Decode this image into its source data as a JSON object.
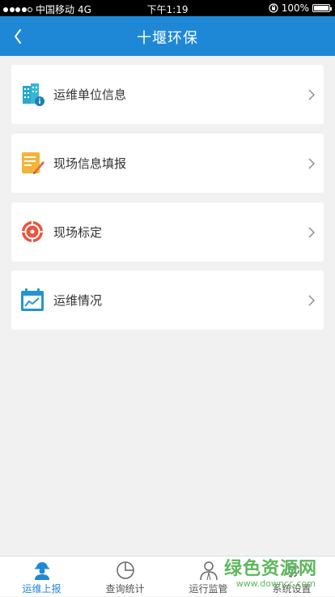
{
  "status_bar": {
    "carrier": "中国移动",
    "network": "4G",
    "time": "下午1:19",
    "battery": "100%"
  },
  "nav": {
    "title": "十堰环保"
  },
  "menu": [
    {
      "label": "运维单位信息",
      "icon": "building-info-icon"
    },
    {
      "label": "现场信息填报",
      "icon": "notepad-pen-icon"
    },
    {
      "label": "现场标定",
      "icon": "target-pin-icon"
    },
    {
      "label": "运维情况",
      "icon": "calendar-chart-icon"
    }
  ],
  "tabs": [
    {
      "label": "运维上报",
      "icon": "worker-icon",
      "active": true
    },
    {
      "label": "查询统计",
      "icon": "pie-chart-icon",
      "active": false
    },
    {
      "label": "运行监管",
      "icon": "person-icon",
      "active": false
    },
    {
      "label": "系统设置",
      "icon": "gear-icon",
      "active": false
    }
  ],
  "watermark": {
    "text": "绿色资源网",
    "url": "www.downcc.com"
  },
  "colors": {
    "primary": "#1e88d6",
    "background": "#f1f1f1"
  }
}
